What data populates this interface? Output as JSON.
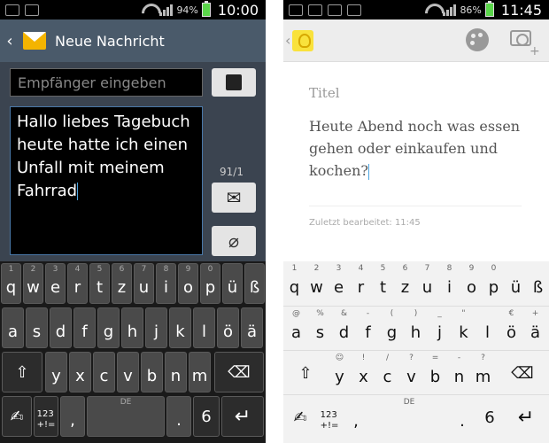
{
  "phone1": {
    "status": {
      "battery": "94%",
      "time": "10:00"
    },
    "header": {
      "title": "Neue Nachricht"
    },
    "recipient_placeholder": "Empfänger eingeben",
    "message_lines": [
      "Hallo liebes Tagebuch",
      "heute hatte ich einen",
      "Unfall mit meinem",
      "Fahrrad"
    ],
    "counter": "91/1",
    "keyboard": {
      "row1": [
        "q",
        "w",
        "e",
        "r",
        "t",
        "z",
        "u",
        "i",
        "o",
        "p",
        "ü",
        "ß"
      ],
      "row1_hints": [
        "1",
        "2",
        "3",
        "4",
        "5",
        "6",
        "7",
        "8",
        "9",
        "0",
        "",
        ""
      ],
      "row2": [
        "a",
        "s",
        "d",
        "f",
        "g",
        "h",
        "j",
        "k",
        "l",
        "ö",
        "ä"
      ],
      "row2_hints": [
        "",
        "",
        "",
        "",
        "",
        "",
        "",
        "",
        "",
        "",
        ""
      ],
      "row3": [
        "y",
        "x",
        "c",
        "v",
        "b",
        "n",
        "m"
      ],
      "num_key": "123\n+!=",
      "comma": ",",
      "space_hint": "DE",
      "period": "."
    }
  },
  "phone2": {
    "status": {
      "battery": "86%",
      "time": "11:45"
    },
    "note_title": "Titel",
    "note_body_lines": [
      "Heute Abend noch was essen",
      "gehen oder einkaufen und",
      "kochen?"
    ],
    "edited": "Zuletzt bearbeitet: 11:45",
    "keyboard": {
      "row1": [
        "q",
        "w",
        "e",
        "r",
        "t",
        "z",
        "u",
        "i",
        "o",
        "p",
        "ü",
        "ß"
      ],
      "row1_hints": [
        "1",
        "2",
        "3",
        "4",
        "5",
        "6",
        "7",
        "8",
        "9",
        "0",
        "",
        ""
      ],
      "row2": [
        "a",
        "s",
        "d",
        "f",
        "g",
        "h",
        "j",
        "k",
        "l",
        "ö",
        "ä"
      ],
      "row2_hints": [
        "@",
        "%",
        "&",
        "-",
        "(",
        ")",
        "_",
        "\"",
        "",
        "€",
        "+"
      ],
      "row3": [
        "y",
        "x",
        "c",
        "v",
        "b",
        "n",
        "m"
      ],
      "row3_hints": [
        "☺",
        "!",
        "/",
        "?",
        "=",
        "-",
        "?"
      ],
      "num_key": "123\n+!=",
      "comma": ",",
      "space_hint": "DE",
      "period": "."
    }
  }
}
